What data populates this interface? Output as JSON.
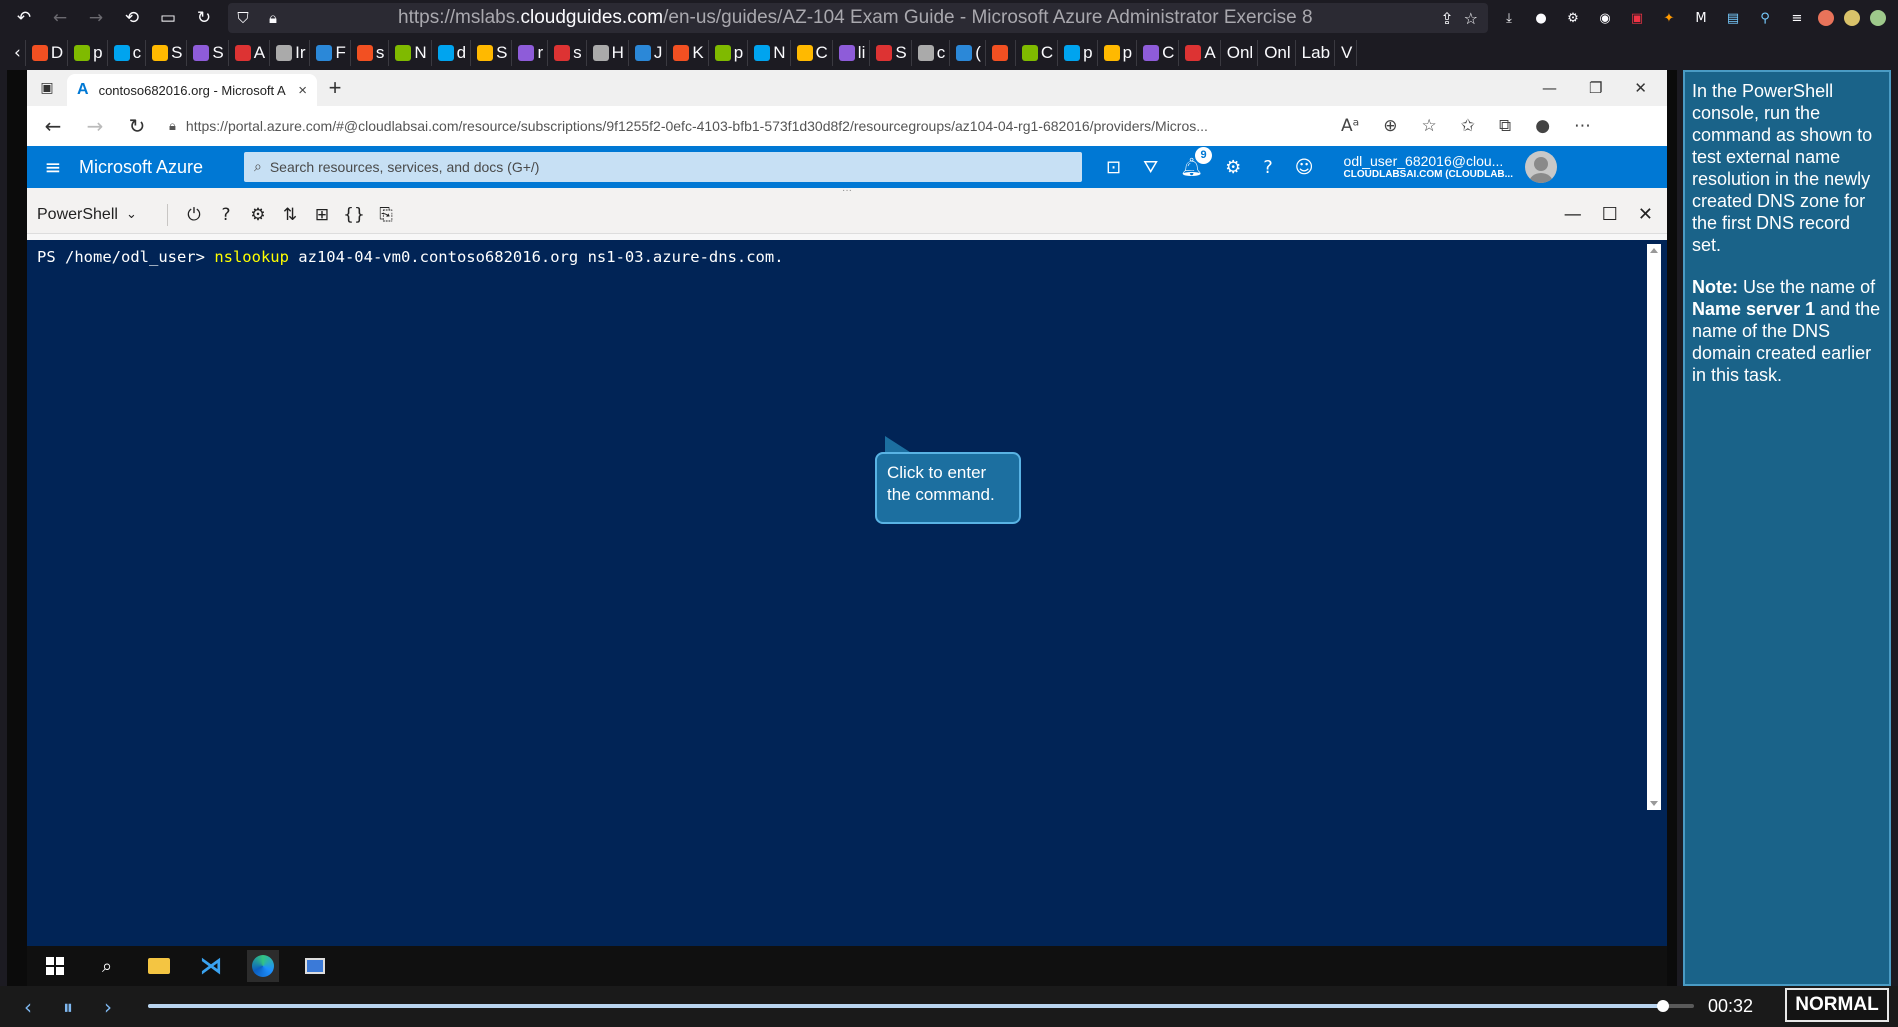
{
  "firefox": {
    "url_prefix": "https://mslabs.",
    "url_domain": "cloudguides.com",
    "url_suffix": "/en-us/guides/AZ-104 Exam Guide - Microsoft Azure Administrator Exercise 8",
    "bookmarks": [
      "D",
      "p",
      "c",
      "S",
      "S",
      "A",
      "Ir",
      "F",
      "s",
      "N",
      "d",
      "S",
      "r",
      "s",
      "H",
      "J",
      "K",
      "p",
      "N",
      "C",
      "li",
      "S",
      "c",
      "(",
      "",
      "C",
      "p",
      "p",
      "C",
      "A"
    ],
    "tabs_right": [
      "Onl",
      "Onl",
      "Lab",
      "V"
    ]
  },
  "edge": {
    "tab_title": "contoso682016.org - Microsoft A",
    "address": "https://portal.azure.com/#@cloudlabsai.com/resource/subscriptions/9f1255f2-0efc-4103-bfb1-573f1d30d8f2/resourcegroups/az104-04-rg1-682016/providers/Micros..."
  },
  "azure": {
    "brand": "Microsoft Azure",
    "search_placeholder": "Search resources, services, and docs (G+/)",
    "notification_count": "9",
    "user_name": "odl_user_682016@clou...",
    "user_directory": "CLOUDLABSAI.COM (CLOUDLAB..."
  },
  "cloudshell": {
    "shell": "PowerShell",
    "prompt": "PS /home/odl_user> ",
    "command_keyword": "nslookup",
    "command_args": " az104-04-vm0.contoso682016.org ns1-03.azure-dns.com.",
    "callout": "Click to enter the command."
  },
  "instructions": {
    "step": "In the PowerShell console, run the command as shown to test external name resolution in the newly created DNS zone for the first DNS record set.",
    "note_label": "Note:",
    "note_text_1": " Use the name of ",
    "note_bold": "Name server 1",
    "note_text_2": " and the name of the DNS domain created earlier in this task."
  },
  "player": {
    "time": "00:32",
    "mode": "NORMAL",
    "progress_fraction": 0.98
  },
  "colors": {
    "azure_blue": "#0078d4",
    "terminal_bg": "#012456",
    "command_yellow": "#ffff00",
    "panel_bg": "#1a6389"
  }
}
